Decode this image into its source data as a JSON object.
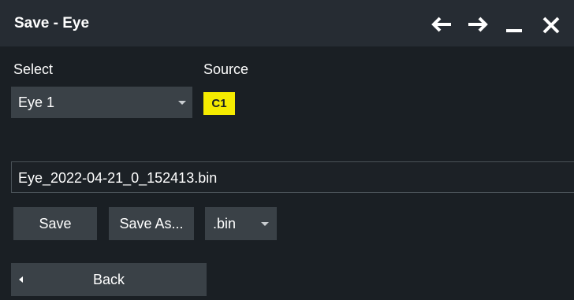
{
  "window": {
    "title": "Save - Eye",
    "controls": {
      "back_icon": "arrow-left-icon",
      "forward_icon": "arrow-right-icon",
      "minimize_icon": "minimize-icon",
      "close_icon": "close-icon"
    }
  },
  "select": {
    "label": "Select",
    "value": "Eye 1"
  },
  "source": {
    "label": "Source",
    "value": "C1",
    "color": "#f5eb00"
  },
  "file": {
    "name": "Eye_2022-04-21_0_152413.bin"
  },
  "actions": {
    "save_label": "Save",
    "save_as_label": "Save As...",
    "format_value": ".bin"
  },
  "nav": {
    "back_label": "Back"
  }
}
